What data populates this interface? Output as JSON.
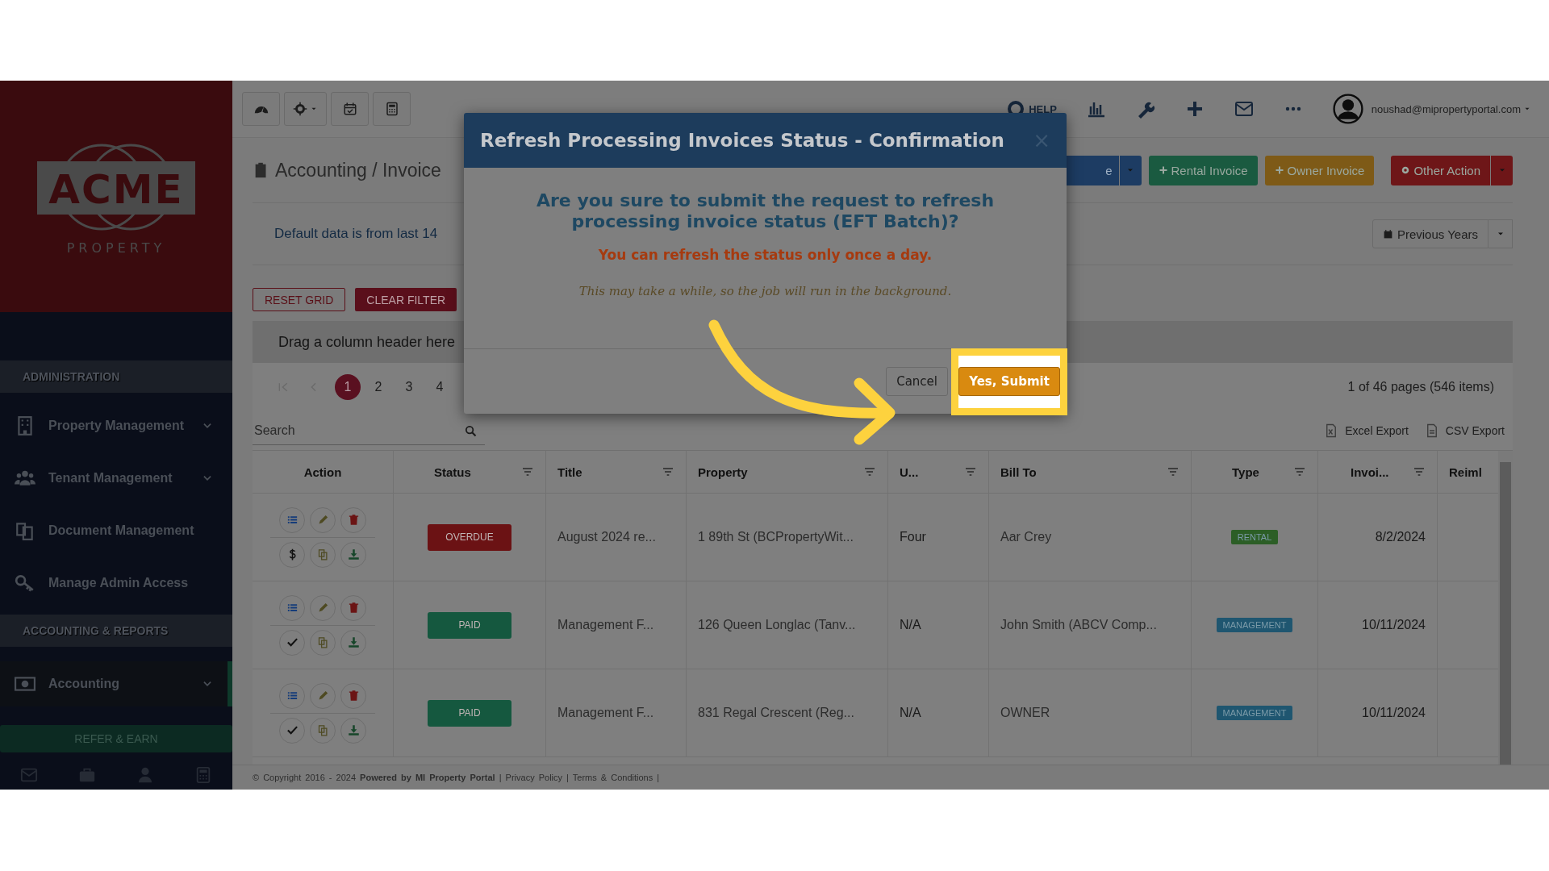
{
  "sidebar": {
    "logo": {
      "name": "ACME",
      "tagline": "PROPERTY"
    },
    "sections": [
      {
        "title": "ADMINISTRATION",
        "items": [
          {
            "label": "Property Management",
            "expandable": true,
            "selected": false
          },
          {
            "label": "Tenant Management",
            "expandable": true,
            "selected": false
          },
          {
            "label": "Document Management",
            "expandable": false,
            "selected": false
          },
          {
            "label": "Manage Admin Access",
            "expandable": false,
            "selected": false
          }
        ]
      },
      {
        "title": "ACCOUNTING & REPORTS",
        "items": [
          {
            "label": "Accounting",
            "expandable": true,
            "selected": true
          }
        ]
      }
    ],
    "refer_button": "REFER & EARN"
  },
  "top_nav": {
    "help_label": "HELP",
    "user_email": "noushad@mipropertyportal.com"
  },
  "page": {
    "breadcrumb": "Accounting / Invoice",
    "actions": [
      {
        "label": "e",
        "color": "#1d3c63",
        "dropdown": true
      },
      {
        "label": "Rental Invoice",
        "color": "#1a5a40",
        "dropdown": false
      },
      {
        "label": "Owner Invoice",
        "color": "#7e5a17",
        "dropdown": false
      },
      {
        "label": "Other Action",
        "color": "#6e1618",
        "dropdown": true
      }
    ],
    "info": "Default data is from last 14",
    "period_button": "Previous Years"
  },
  "grid_buttons": [
    {
      "label": "RESET GRID",
      "kind": "outline"
    },
    {
      "label": "CLEAR FILTER",
      "kind": "filled"
    }
  ],
  "group_hint": "Drag a column header here",
  "pager": {
    "pages": [
      {
        "label": "1",
        "selected": true
      },
      {
        "label": "2",
        "selected": false
      },
      {
        "label": "3",
        "selected": false
      },
      {
        "label": "4",
        "selected": false
      }
    ],
    "summary": "1 of 46 pages (546 items)"
  },
  "search": {
    "placeholder": "Search"
  },
  "exports": [
    "Excel Export",
    "CSV Export"
  ],
  "table": {
    "columns": [
      {
        "label": "Action",
        "filter": false
      },
      {
        "label": "Status",
        "filter": true
      },
      {
        "label": "Title",
        "filter": true
      },
      {
        "label": "Property",
        "filter": true
      },
      {
        "label": "U...",
        "filter": true
      },
      {
        "label": "Bill To",
        "filter": true
      },
      {
        "label": "Type",
        "filter": true
      },
      {
        "label": "Invoi...",
        "filter": true
      },
      {
        "label": "Reiml",
        "filter": false
      }
    ],
    "rows": [
      {
        "kind": "unpaid",
        "status": {
          "text": "OVERDUE",
          "color": "#6b1214"
        },
        "title": "August 2024 re...",
        "property": "1 89th St (BCPropertyWit...",
        "unit": "Four",
        "bill_to": "Aar Crey",
        "type": {
          "text": "RENTAL",
          "color": "#2c5e26"
        },
        "invoice_date": "8/2/2024"
      },
      {
        "kind": "paid",
        "status": {
          "text": "PAID",
          "color": "#15583f"
        },
        "title": "Management F...",
        "property": "126 Queen Longlac (Tanv...",
        "unit": "N/A",
        "bill_to": "John Smith (ABCV Comp...",
        "type": {
          "text": "MANAGEMENT",
          "color": "#1f5670"
        },
        "invoice_date": "10/11/2024"
      },
      {
        "kind": "paid",
        "status": {
          "text": "PAID",
          "color": "#15583f"
        },
        "title": "Management F...",
        "property": "831 Regal Crescent (Reg...",
        "unit": "N/A",
        "bill_to": "OWNER",
        "type": {
          "text": "MANAGEMENT",
          "color": "#1f5670"
        },
        "invoice_date": "10/11/2024"
      }
    ]
  },
  "footer": "© Copyright 2016 - 2024 **Powered by MI Property Portal** | Privacy Policy | Terms & Conditions |",
  "modal": {
    "title": "Refresh Processing Invoices Status - Confirmation",
    "close_label": "×",
    "question": "Are you sure to submit the request to refresh processing invoice status (EFT Batch)?",
    "warning": "You can refresh the status only once a day.",
    "note": "This may take a while, so the job will run in the background.",
    "buttons": [
      {
        "label": "Cancel",
        "kind": "default",
        "highlighted": false
      },
      {
        "label": "Yes, Submit",
        "kind": "primary",
        "highlighted": true
      }
    ]
  }
}
